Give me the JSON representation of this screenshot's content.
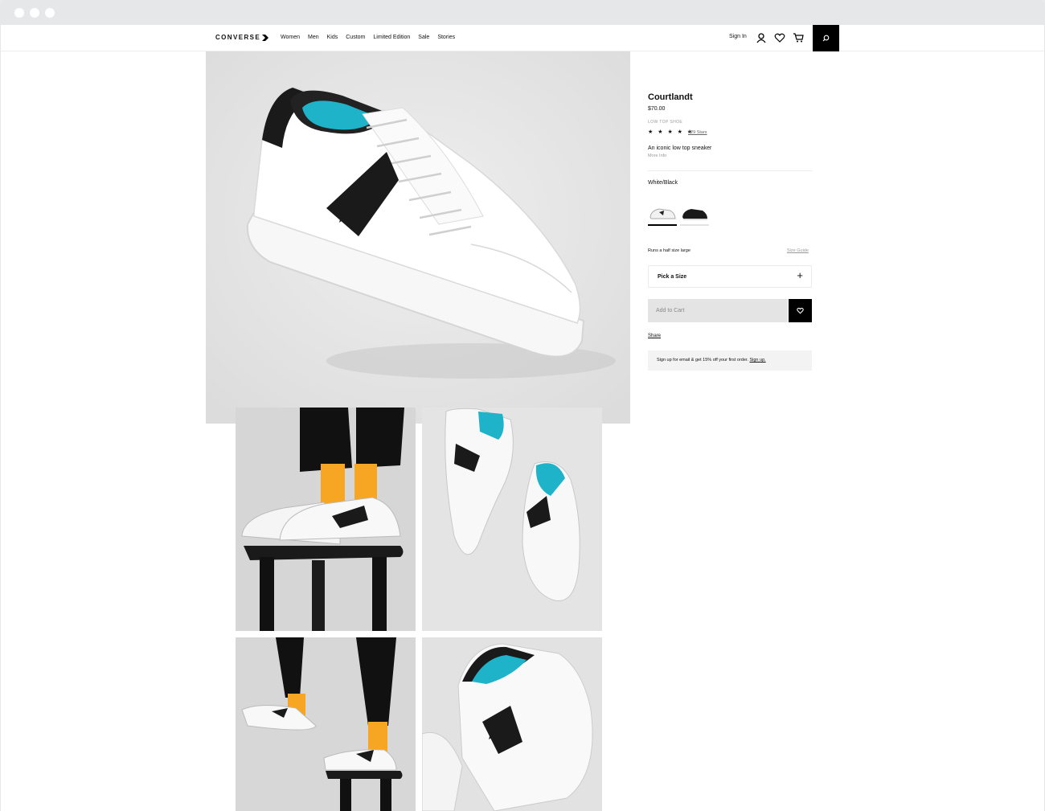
{
  "brand": {
    "logo_text": "CONVERSE"
  },
  "nav": {
    "items": [
      "Women",
      "Men",
      "Kids",
      "Custom",
      "Limited Edition",
      "Sale",
      "Stories"
    ]
  },
  "header": {
    "sign_in": "Sign In"
  },
  "product": {
    "name": "Courtlandt",
    "price": "$70.00",
    "type": "LOW TOP SHOE",
    "stars": "★ ★ ★ ★ ★",
    "rating": 5,
    "reviews": "429 Stars",
    "description": "An iconic low top sneaker",
    "more_info": "More Info",
    "color": "White/Black",
    "fit_note": "Runs a half size large",
    "size_guide": "Size Guide",
    "size_picker": "Pick a Size",
    "add_to_cart": "Add to Cart",
    "share": "Share",
    "promo_text": "Sign up for email & get 15% off your first order.",
    "promo_link": "Sign up."
  },
  "colors": {
    "accent": "#000000",
    "teal_insole": "#1fb3c9",
    "sock": "#f6a623"
  }
}
